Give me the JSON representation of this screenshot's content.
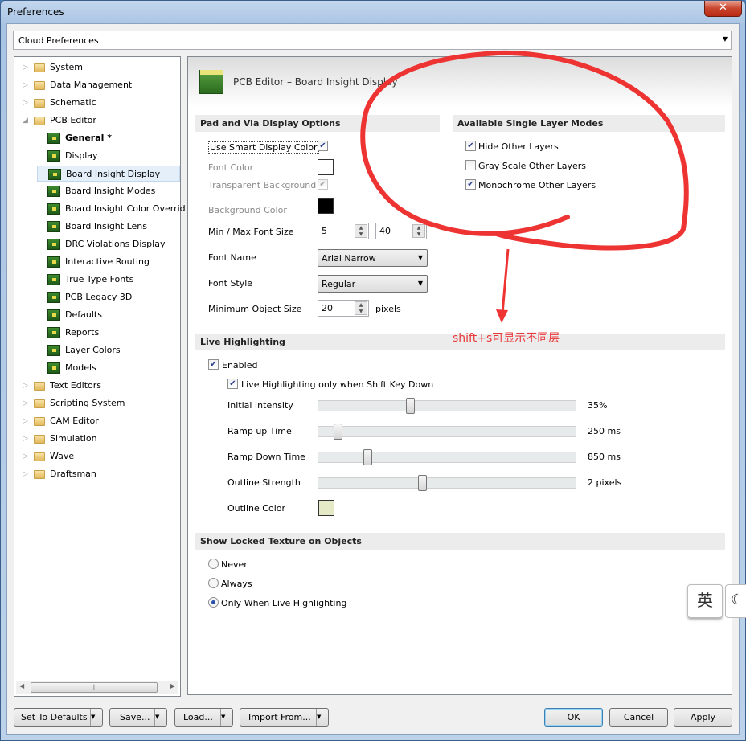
{
  "window": {
    "title": "Preferences",
    "close": "✕"
  },
  "cloud_combo": "Cloud Preferences",
  "tree": [
    {
      "label": "System",
      "type": "folder",
      "level": 0
    },
    {
      "label": "Data Management",
      "type": "folder",
      "level": 0
    },
    {
      "label": "Schematic",
      "type": "folder",
      "level": 0
    },
    {
      "label": "PCB Editor",
      "type": "folder-open",
      "level": 0
    },
    {
      "label": "General *",
      "type": "page",
      "level": 1,
      "bold": true
    },
    {
      "label": "Display",
      "type": "page",
      "level": 1
    },
    {
      "label": "Board Insight Display",
      "type": "page",
      "level": 1,
      "selected": true
    },
    {
      "label": "Board Insight Modes",
      "type": "page",
      "level": 1
    },
    {
      "label": "Board Insight Color Overrid",
      "type": "page",
      "level": 1
    },
    {
      "label": "Board Insight Lens",
      "type": "page",
      "level": 1
    },
    {
      "label": "DRC Violations Display",
      "type": "page",
      "level": 1
    },
    {
      "label": "Interactive Routing",
      "type": "page",
      "level": 1
    },
    {
      "label": "True Type Fonts",
      "type": "page",
      "level": 1
    },
    {
      "label": "PCB Legacy 3D",
      "type": "page",
      "level": 1
    },
    {
      "label": "Defaults",
      "type": "page",
      "level": 1
    },
    {
      "label": "Reports",
      "type": "page",
      "level": 1
    },
    {
      "label": "Layer Colors",
      "type": "page",
      "level": 1
    },
    {
      "label": "Models",
      "type": "page",
      "level": 1
    },
    {
      "label": "Text Editors",
      "type": "folder",
      "level": 0
    },
    {
      "label": "Scripting System",
      "type": "folder",
      "level": 0
    },
    {
      "label": "CAM Editor",
      "type": "folder",
      "level": 0
    },
    {
      "label": "Simulation",
      "type": "folder",
      "level": 0
    },
    {
      "label": "Wave",
      "type": "folder",
      "level": 0
    },
    {
      "label": "Draftsman",
      "type": "folder",
      "level": 0
    }
  ],
  "page_title": "PCB Editor – Board Insight Display",
  "pad_via": {
    "header": "Pad and Via Display Options",
    "use_smart": "Use Smart Display Color",
    "use_smart_checked": true,
    "font_color": "Font Color",
    "font_color_value": "#ffffff",
    "transparent_bg": "Transparent Background",
    "transparent_checked": true,
    "bg_color": "Background Color",
    "bg_color_value": "#000000",
    "min_max": "Min / Max Font Size",
    "min": "5",
    "max": "40",
    "font_name": "Font Name",
    "font_name_value": "Arial Narrow",
    "font_style": "Font Style",
    "font_style_value": "Regular",
    "min_obj": "Minimum Object Size",
    "min_obj_value": "20",
    "pixels": "pixels"
  },
  "layer_modes": {
    "header": "Available Single Layer Modes",
    "items": [
      {
        "label": "Hide Other Layers",
        "checked": true
      },
      {
        "label": "Gray Scale Other Layers",
        "checked": false
      },
      {
        "label": "Monochrome Other Layers",
        "checked": true
      }
    ]
  },
  "live": {
    "header": "Live Highlighting",
    "enabled": "Enabled",
    "shift_only": "Live Highlighting only when Shift Key Down",
    "sliders": [
      {
        "label": "Initial Intensity",
        "value": "35%",
        "fraction": 0.35
      },
      {
        "label": "Ramp up Time",
        "value": "250 ms",
        "fraction": 0.06
      },
      {
        "label": "Ramp Down Time",
        "value": "850 ms",
        "fraction": 0.18
      },
      {
        "label": "Outline Strength",
        "value": "2 pixels",
        "fraction": 0.4
      }
    ],
    "outline_color": "Outline Color",
    "outline_color_value": "#e6e9c6"
  },
  "locked": {
    "header": "Show Locked Texture on Objects",
    "options": [
      {
        "label": "Never",
        "selected": false
      },
      {
        "label": "Always",
        "selected": false
      },
      {
        "label": "Only When Live Highlighting",
        "selected": true
      }
    ]
  },
  "buttons": {
    "defaults": "Set To Defaults",
    "save": "Save...",
    "load": "Load...",
    "import": "Import From...",
    "ok": "OK",
    "cancel": "Cancel",
    "apply": "Apply"
  },
  "annotation": {
    "text": "shift+s可显示不同层",
    "color": "#e8393b"
  },
  "ime": {
    "label": "英",
    "moon": "☾"
  }
}
